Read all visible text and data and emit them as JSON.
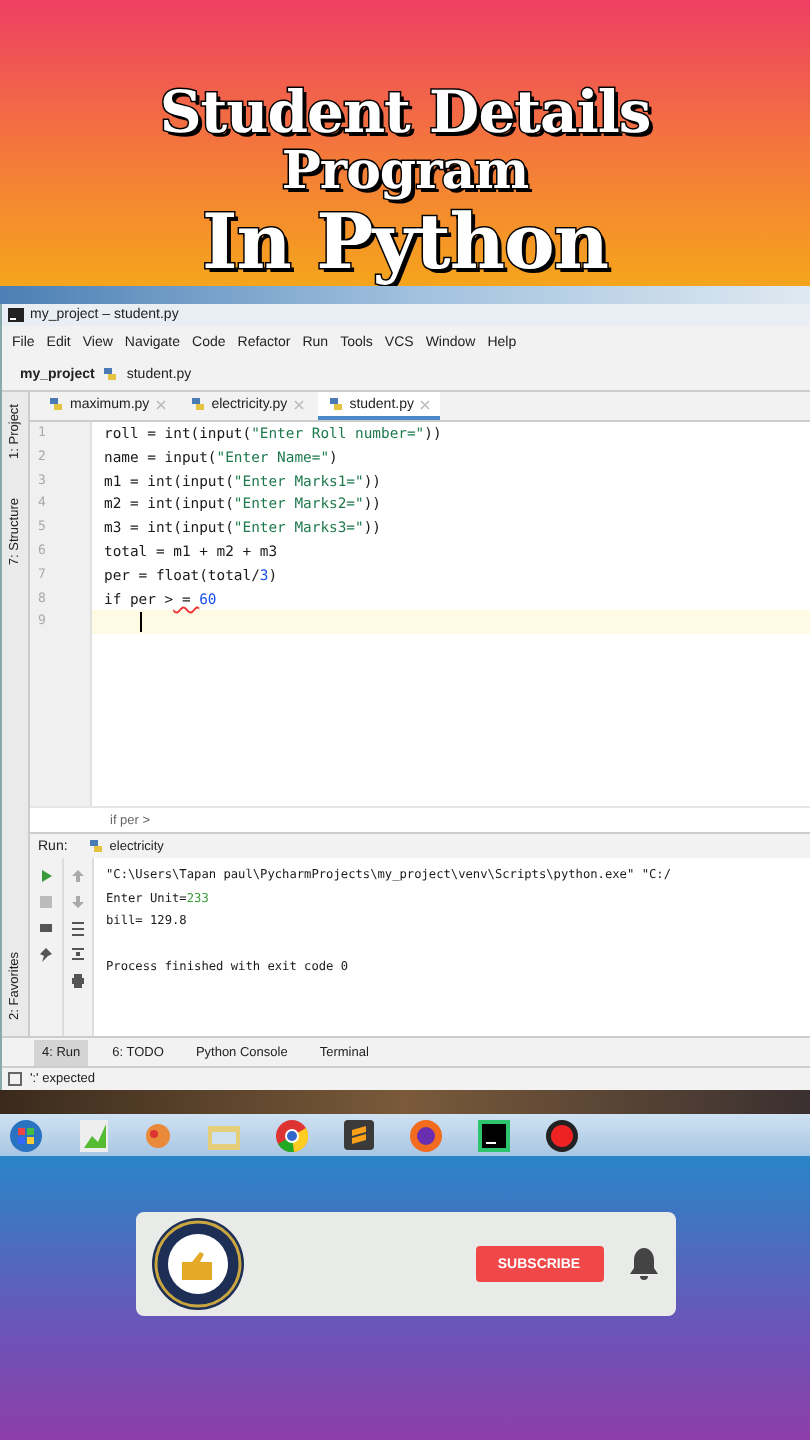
{
  "headline": [
    "Student Details",
    "Program",
    "In Python"
  ],
  "window": {
    "title": "my_project – student.py"
  },
  "menu": [
    "File",
    "Edit",
    "View",
    "Navigate",
    "Code",
    "Refactor",
    "Run",
    "Tools",
    "VCS",
    "Window",
    "Help"
  ],
  "breadcrumb": [
    "my_project",
    "student.py"
  ],
  "side_tools": [
    "1: Project",
    "7: Structure"
  ],
  "tabs": [
    {
      "label": "maximum.py",
      "selected": false
    },
    {
      "label": "electricity.py",
      "selected": false
    },
    {
      "label": "student.py",
      "selected": true
    }
  ],
  "code": [
    {
      "number": "1",
      "current": false,
      "tokens": [
        {
          "text": "roll = int(input(",
          "kind": "plain"
        },
        {
          "text": "\"Enter Roll number=\"",
          "kind": "string"
        },
        {
          "text": "))",
          "kind": "plain"
        }
      ]
    },
    {
      "number": "2",
      "current": false,
      "tokens": [
        {
          "text": "name = input(",
          "kind": "plain"
        },
        {
          "text": "\"Enter Name=\"",
          "kind": "string"
        },
        {
          "text": ")",
          "kind": "plain"
        }
      ]
    },
    {
      "number": "3",
      "current": false,
      "tokens": [
        {
          "text": "m1 = int(input(",
          "kind": "plain"
        },
        {
          "text": "\"Enter Marks1=\"",
          "kind": "string"
        },
        {
          "text": "))",
          "kind": "plain"
        }
      ]
    },
    {
      "number": "4",
      "current": false,
      "tokens": [
        {
          "text": "m2 = int(input(",
          "kind": "plain"
        },
        {
          "text": "\"Enter Marks2=\"",
          "kind": "string"
        },
        {
          "text": "))",
          "kind": "plain"
        }
      ]
    },
    {
      "number": "5",
      "current": false,
      "tokens": [
        {
          "text": "m3 = int(input(",
          "kind": "plain"
        },
        {
          "text": "\"Enter Marks3=\"",
          "kind": "string"
        },
        {
          "text": "))",
          "kind": "plain"
        }
      ]
    },
    {
      "number": "6",
      "current": false,
      "tokens": [
        {
          "text": "total = m1 + m2 + m3",
          "kind": "plain"
        }
      ]
    },
    {
      "number": "7",
      "current": false,
      "tokens": [
        {
          "text": "per = float(total/",
          "kind": "plain"
        },
        {
          "text": "3",
          "kind": "number"
        },
        {
          "text": ")",
          "kind": "plain"
        }
      ]
    },
    {
      "number": "8",
      "current": false,
      "tokens": [
        {
          "text": "if per >",
          "kind": "plain"
        },
        {
          "text": " = ",
          "kind": "error"
        },
        {
          "text": "60",
          "kind": "number"
        }
      ]
    },
    {
      "number": "9",
      "current": true
    }
  ],
  "editor_breadcrumb": "if per >",
  "run": {
    "label": "Run:",
    "tab": "electricity",
    "output": [
      {
        "tokens": [
          {
            "text": "\"C:\\Users\\Tapan paul\\PycharmProjects\\my_project\\venv\\Scripts\\python.exe\" \"C:/",
            "kind": "plain"
          }
        ]
      },
      {
        "tokens": [
          {
            "text": "Enter Unit=",
            "kind": "plain"
          },
          {
            "text": "233",
            "kind": "input"
          }
        ]
      },
      {
        "tokens": [
          {
            "text": "bill= 129.8",
            "kind": "plain"
          }
        ]
      },
      {
        "tokens": [
          {
            "text": "Process finished with exit code 0",
            "kind": "plain"
          }
        ]
      }
    ],
    "favorites": "2: Favorites"
  },
  "tool_tabs": [
    {
      "label": "4: Run",
      "selected": true
    },
    {
      "label": "6: TODO",
      "selected": false
    },
    {
      "label": "Python Console",
      "selected": false
    },
    {
      "label": "Terminal",
      "selected": false
    }
  ],
  "status": "':' expected",
  "subscribe": {
    "button": "SUBSCRIBE"
  }
}
